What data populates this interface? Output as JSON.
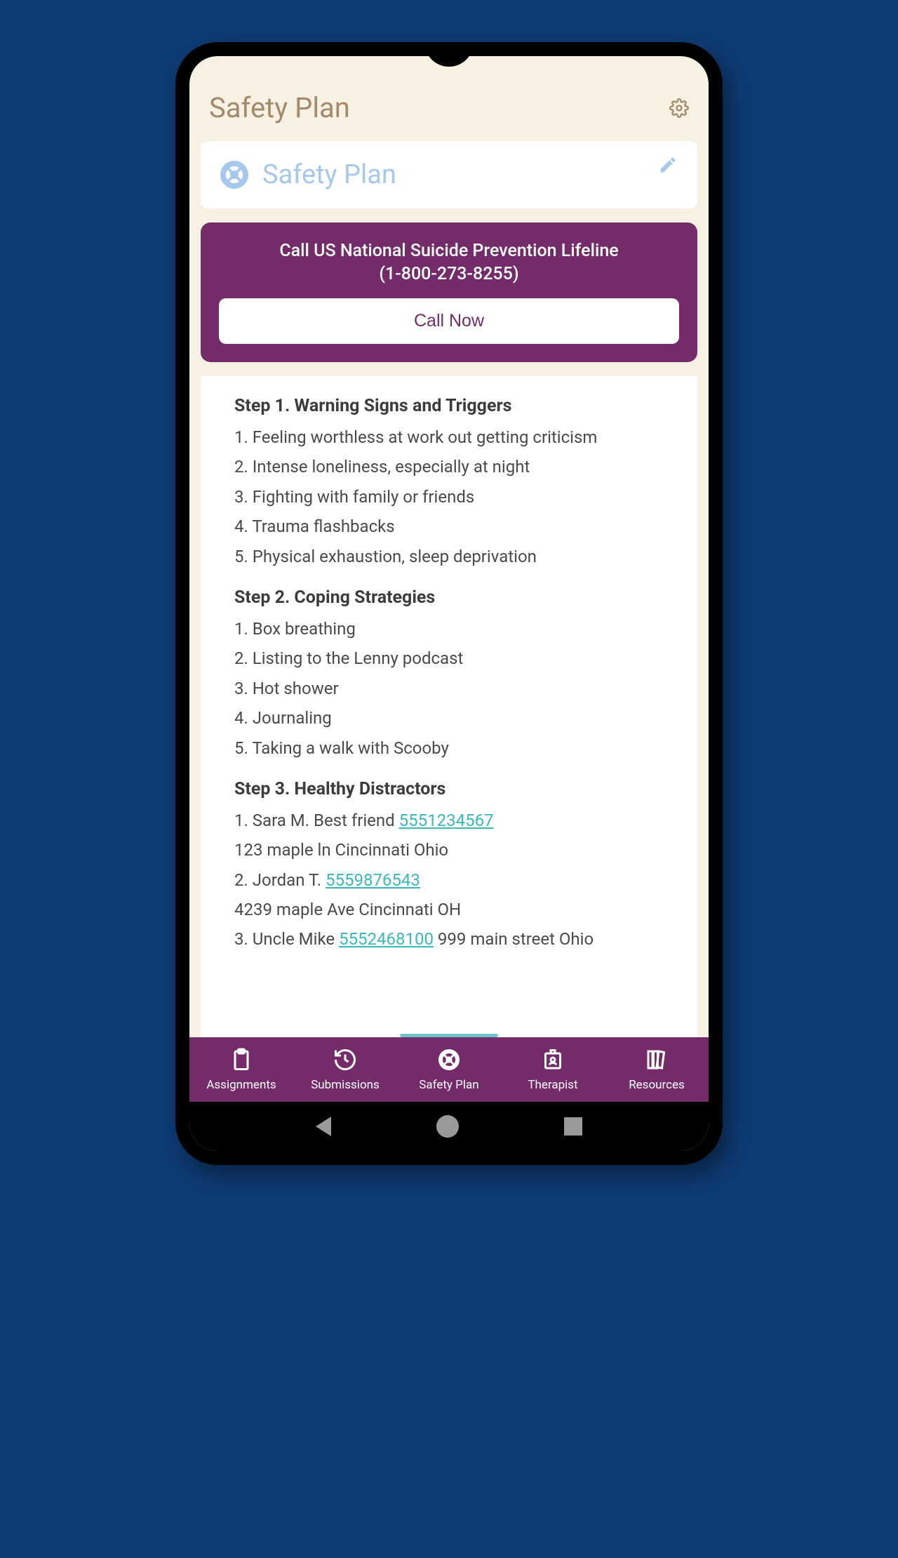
{
  "header": {
    "title": "Safety Plan"
  },
  "card": {
    "title": "Safety Plan"
  },
  "lifeline": {
    "line1": "Call US National Suicide Prevention Lifeline",
    "line2": "(1-800-273-8255)",
    "call_button": "Call Now"
  },
  "steps": [
    {
      "title": "Step 1. Warning Signs and Triggers",
      "items": [
        {
          "n": "1.",
          "text": "Feeling worthless at work out getting criticism"
        },
        {
          "n": "2.",
          "text": "Intense loneliness, especially at night"
        },
        {
          "n": "3.",
          "text": "Fighting with family or friends"
        },
        {
          "n": "4.",
          "text": "Trauma flashbacks"
        },
        {
          "n": "5.",
          "text": "Physical exhaustion, sleep deprivation"
        }
      ]
    },
    {
      "title": "Step 2. Coping Strategies",
      "items": [
        {
          "n": "1.",
          "text": "Box breathing"
        },
        {
          "n": "2.",
          "text": "Listing to the Lenny podcast"
        },
        {
          "n": "3.",
          "text": "Hot shower"
        },
        {
          "n": "4.",
          "text": "Journaling"
        },
        {
          "n": "5.",
          "text": "Taking a walk with Scooby"
        }
      ]
    },
    {
      "title": "Step 3. Healthy Distractors",
      "items": [
        {
          "n": "1.",
          "pre": "Sara M. Best friend ",
          "phone": "5551234567",
          "post": ""
        },
        {
          "n": "",
          "pre": "123 maple ln Cincinnati Ohio",
          "phone": "",
          "post": ""
        },
        {
          "n": "2.",
          "pre": "Jordan T. ",
          "phone": "5559876543",
          "post": ""
        },
        {
          "n": "",
          "pre": "4239 maple Ave Cincinnati OH",
          "phone": "",
          "post": ""
        },
        {
          "n": "3.",
          "pre": "Uncle Mike ",
          "phone": "5552468100",
          "post": " 999 main street Ohio"
        }
      ]
    }
  ],
  "nav": {
    "items": [
      {
        "label": "Assignments"
      },
      {
        "label": "Submissions"
      },
      {
        "label": "Safety Plan"
      },
      {
        "label": "Therapist"
      },
      {
        "label": "Resources"
      }
    ]
  }
}
